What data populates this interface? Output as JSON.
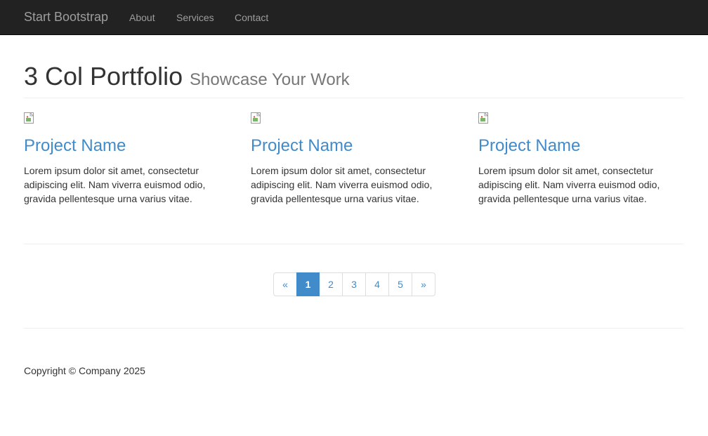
{
  "navbar": {
    "brand": "Start Bootstrap",
    "links": [
      {
        "label": "About"
      },
      {
        "label": "Services"
      },
      {
        "label": "Contact"
      }
    ]
  },
  "header": {
    "title": "3 Col Portfolio",
    "subtitle": "Showcase Your Work"
  },
  "projects": [
    {
      "name": "Project Name",
      "description": "Lorem ipsum dolor sit amet, consectetur adipiscing elit. Nam viverra euismod odio, gravida pellentesque urna varius vitae."
    },
    {
      "name": "Project Name",
      "description": "Lorem ipsum dolor sit amet, consectetur adipiscing elit. Nam viverra euismod odio, gravida pellentesque urna varius vitae."
    },
    {
      "name": "Project Name",
      "description": "Lorem ipsum dolor sit amet, consectetur adipiscing elit. Nam viverra euismod odio, gravida pellentesque urna varius vitae."
    }
  ],
  "pagination": {
    "prev": "«",
    "pages": [
      "1",
      "2",
      "3",
      "4",
      "5"
    ],
    "next": "»",
    "active_page": "1"
  },
  "footer": {
    "copyright": "Copyright © Company 2025"
  },
  "colors": {
    "navbar_bg": "#222222",
    "link": "#428bca",
    "active_page_bg": "#428bca"
  }
}
